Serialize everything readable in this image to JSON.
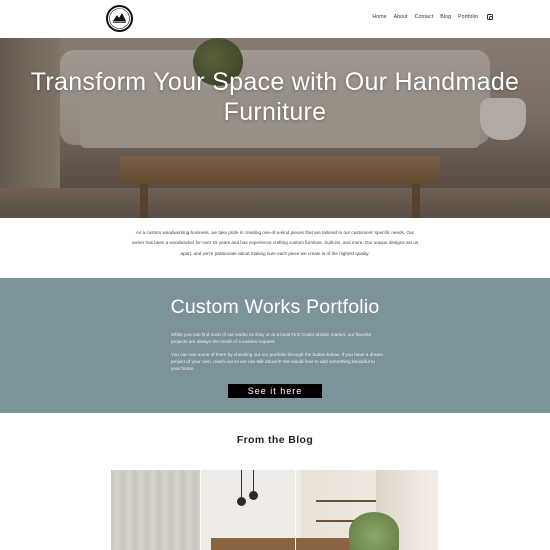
{
  "header": {
    "logo_alt": "Handmade woodworking logo",
    "nav": [
      "Home",
      "About",
      "Contact",
      "Blog",
      "Portfolio"
    ],
    "social_icon": "instagram-icon"
  },
  "hero": {
    "title": "Transform Your Space with Our Handmade Furniture"
  },
  "intro": {
    "text": "As a custom woodworking business, we take pride in creating one-of-a-kind pieces that are tailored to our customers' specific needs. Our owner has been a woodworker for over 15 years and has experience crafting custom furniture, built-ins, and more. Our unique designs set us apart, and we're passionate about making sure each piece we create is of the highest quality."
  },
  "portfolio": {
    "title": "Custom Works Portfolio",
    "paragraph1": "While you can find most of our works on Etsy or at a local First Coast artisan market, our favorite projects are always the result of a custom request.",
    "paragraph2": "You can see some of them by checking out our portfolio through the button below. If you have a dream project of your own, reach out so we can talk about it! We would love to add something beautiful to your home.",
    "button_label": "See it here"
  },
  "blog": {
    "title": "From the Blog"
  },
  "colors": {
    "portfolio_bg": "#7d939a",
    "button_bg": "#000000"
  }
}
